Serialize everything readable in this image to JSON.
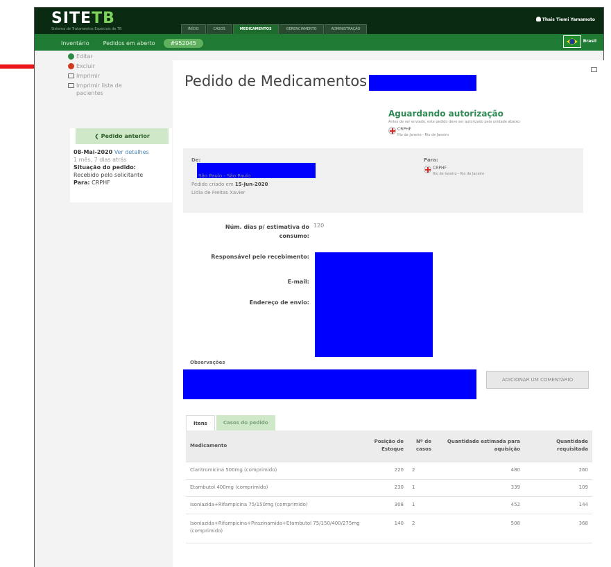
{
  "app": {
    "logo_main": "SITE",
    "logo_accent": "TB",
    "logo_sub": "Sistema de Tratamentos Especiais de TB"
  },
  "nav": {
    "tabs": [
      "Início",
      "Casos",
      "Medicamentos",
      "Gerenciamento",
      "Administração"
    ],
    "active": "Medicamentos",
    "user": "Thais Tiemi Yamamoto"
  },
  "subnav": {
    "links": [
      "Inventário",
      "Pedidos em aberto"
    ],
    "active_pill": "#952045",
    "country": "Brasil"
  },
  "side": {
    "actions": {
      "edit": "Editar",
      "delete": "Excluir",
      "print": "Imprimir",
      "print_list": "Imprimir lista de pacientes"
    },
    "prev_button": "❮ Pedido anterior",
    "prev_date": "08-Mai-2020",
    "prev_details_link": "Ver detalhes",
    "prev_elapsed": "1 mês, 7 dias atrás",
    "status_label": "Situação do pedido:",
    "status_value": "Recebido pelo solicitante",
    "to_label": "Para:",
    "to_value": "CRPHF"
  },
  "main": {
    "title": "Pedido de Medicamentos #",
    "status": "Aguardando autorização",
    "status_note": "Antes de ser enviado, este pedido deve ser autorizado pela unidade abaixo:",
    "auth_unit": "CRPHF",
    "auth_unit_location": "Rio de Janeiro - Rio de Janeiro",
    "from_label": "De:",
    "from_location": "São Paulo - São Paulo",
    "created_label": "Pedido criado em",
    "created_date": "15-Jun-2020",
    "created_by": "Lidia de Freitas Xavier",
    "to_label": "Para:",
    "to_unit": "CRPHF",
    "to_location": "Rio de Janeiro - Rio de Janeiro",
    "days_label_1": "Núm. dias p/ estimativa do",
    "days_label_2": "consumo:",
    "days_value": "120",
    "responsible_label": "Responsável pelo recebimento:",
    "email_label": "E-mail:",
    "address_label": "Endereço de envio:",
    "obs_label": "Observações",
    "add_comment": "Adicionar um comentário"
  },
  "tabs": [
    "Itens",
    "Casos do pedido"
  ],
  "table": {
    "headers": [
      "Medicamento",
      "Posição de Estoque",
      "Nº de casos",
      "Quantidade estimada para aquisição",
      "Quantidade requisitada"
    ],
    "rows": [
      [
        "Claritromicina 500mg (comprimido)",
        "220",
        "2",
        "480",
        "260"
      ],
      [
        "Etambutol 400mg (comprimido)",
        "230",
        "1",
        "339",
        "109"
      ],
      [
        "Isoniazida+Rifampicina 75/150mg (comprimido)",
        "308",
        "1",
        "452",
        "144"
      ],
      [
        "Isoniazida+Rifampicina+Pirazinamida+Etambutol 75/150/400/275mg (comprimido)",
        "140",
        "2",
        "508",
        "368"
      ]
    ]
  },
  "colors": {
    "topbar": "#0b2a12",
    "subbar": "#1f7a33",
    "accent_green": "#2e8a52",
    "redaction": "#0000ff",
    "arrow": "#e8161b"
  }
}
